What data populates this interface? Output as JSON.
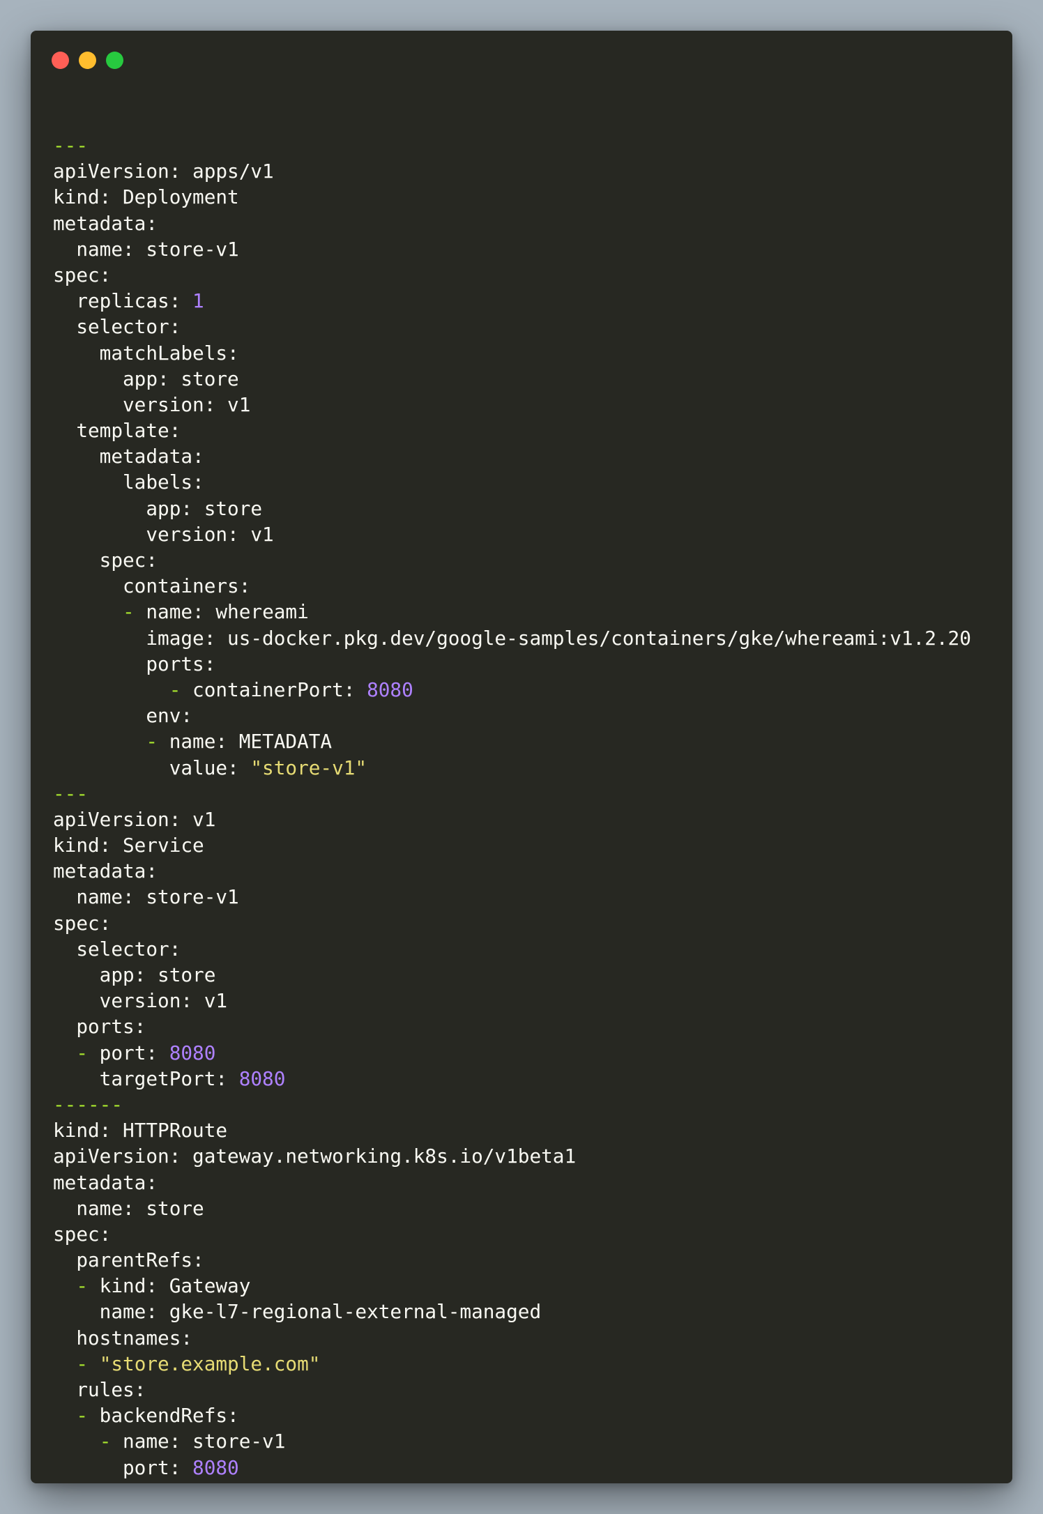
{
  "window": {
    "controls": [
      {
        "name": "close-button",
        "color": "#ff5f56"
      },
      {
        "name": "minimize-button",
        "color": "#ffbd2e"
      },
      {
        "name": "maximize-button",
        "color": "#27c93f"
      }
    ],
    "background": "#272822"
  },
  "colors": {
    "text": "#f8f8f2",
    "number": "#ae81ff",
    "string": "#e6db74",
    "punctuation": "#a6e22e"
  },
  "code": {
    "language": "yaml",
    "lines": [
      [
        {
          "t": "---",
          "c": "punc"
        }
      ],
      [
        {
          "t": "apiVersion: apps/v1",
          "c": "plain"
        }
      ],
      [
        {
          "t": "kind: Deployment",
          "c": "plain"
        }
      ],
      [
        {
          "t": "metadata:",
          "c": "plain"
        }
      ],
      [
        {
          "t": "  name: store-v1",
          "c": "plain"
        }
      ],
      [
        {
          "t": "spec:",
          "c": "plain"
        }
      ],
      [
        {
          "t": "  replicas: ",
          "c": "plain"
        },
        {
          "t": "1",
          "c": "num"
        }
      ],
      [
        {
          "t": "  selector:",
          "c": "plain"
        }
      ],
      [
        {
          "t": "    matchLabels:",
          "c": "plain"
        }
      ],
      [
        {
          "t": "      app: store",
          "c": "plain"
        }
      ],
      [
        {
          "t": "      version: v1",
          "c": "plain"
        }
      ],
      [
        {
          "t": "  template:",
          "c": "plain"
        }
      ],
      [
        {
          "t": "    metadata:",
          "c": "plain"
        }
      ],
      [
        {
          "t": "      labels:",
          "c": "plain"
        }
      ],
      [
        {
          "t": "        app: store",
          "c": "plain"
        }
      ],
      [
        {
          "t": "        version: v1",
          "c": "plain"
        }
      ],
      [
        {
          "t": "    spec:",
          "c": "plain"
        }
      ],
      [
        {
          "t": "      containers:",
          "c": "plain"
        }
      ],
      [
        {
          "t": "      ",
          "c": "plain"
        },
        {
          "t": "-",
          "c": "punc"
        },
        {
          "t": " name: whereami",
          "c": "plain"
        }
      ],
      [
        {
          "t": "        image: us-docker.pkg.dev/google-samples/containers/gke/whereami:v1.2.20",
          "c": "plain"
        }
      ],
      [
        {
          "t": "        ports:",
          "c": "plain"
        }
      ],
      [
        {
          "t": "          ",
          "c": "plain"
        },
        {
          "t": "-",
          "c": "punc"
        },
        {
          "t": " containerPort: ",
          "c": "plain"
        },
        {
          "t": "8080",
          "c": "num"
        }
      ],
      [
        {
          "t": "        env:",
          "c": "plain"
        }
      ],
      [
        {
          "t": "        ",
          "c": "plain"
        },
        {
          "t": "-",
          "c": "punc"
        },
        {
          "t": " name: METADATA",
          "c": "plain"
        }
      ],
      [
        {
          "t": "          value: ",
          "c": "plain"
        },
        {
          "t": "\"store-v1\"",
          "c": "str"
        }
      ],
      [
        {
          "t": "---",
          "c": "punc"
        }
      ],
      [
        {
          "t": "apiVersion: v1",
          "c": "plain"
        }
      ],
      [
        {
          "t": "kind: Service",
          "c": "plain"
        }
      ],
      [
        {
          "t": "metadata:",
          "c": "plain"
        }
      ],
      [
        {
          "t": "  name: store-v1",
          "c": "plain"
        }
      ],
      [
        {
          "t": "spec:",
          "c": "plain"
        }
      ],
      [
        {
          "t": "  selector:",
          "c": "plain"
        }
      ],
      [
        {
          "t": "    app: store",
          "c": "plain"
        }
      ],
      [
        {
          "t": "    version: v1",
          "c": "plain"
        }
      ],
      [
        {
          "t": "  ports:",
          "c": "plain"
        }
      ],
      [
        {
          "t": "  ",
          "c": "plain"
        },
        {
          "t": "-",
          "c": "punc"
        },
        {
          "t": " port: ",
          "c": "plain"
        },
        {
          "t": "8080",
          "c": "num"
        }
      ],
      [
        {
          "t": "    targetPort: ",
          "c": "plain"
        },
        {
          "t": "8080",
          "c": "num"
        }
      ],
      [
        {
          "t": "------",
          "c": "punc"
        }
      ],
      [
        {
          "t": "kind: HTTPRoute",
          "c": "plain"
        }
      ],
      [
        {
          "t": "apiVersion: gateway.networking.k8s.io/v1beta1",
          "c": "plain"
        }
      ],
      [
        {
          "t": "metadata:",
          "c": "plain"
        }
      ],
      [
        {
          "t": "  name: store",
          "c": "plain"
        }
      ],
      [
        {
          "t": "spec:",
          "c": "plain"
        }
      ],
      [
        {
          "t": "  parentRefs:",
          "c": "plain"
        }
      ],
      [
        {
          "t": "  ",
          "c": "plain"
        },
        {
          "t": "-",
          "c": "punc"
        },
        {
          "t": " kind: Gateway",
          "c": "plain"
        }
      ],
      [
        {
          "t": "    name: gke-l7-regional-external-managed",
          "c": "plain"
        }
      ],
      [
        {
          "t": "  hostnames:",
          "c": "plain"
        }
      ],
      [
        {
          "t": "  ",
          "c": "plain"
        },
        {
          "t": "-",
          "c": "punc"
        },
        {
          "t": " ",
          "c": "plain"
        },
        {
          "t": "\"store.example.com\"",
          "c": "str"
        }
      ],
      [
        {
          "t": "  rules:",
          "c": "plain"
        }
      ],
      [
        {
          "t": "  ",
          "c": "plain"
        },
        {
          "t": "-",
          "c": "punc"
        },
        {
          "t": " backendRefs:",
          "c": "plain"
        }
      ],
      [
        {
          "t": "    ",
          "c": "plain"
        },
        {
          "t": "-",
          "c": "punc"
        },
        {
          "t": " name: store-v1",
          "c": "plain"
        }
      ],
      [
        {
          "t": "      port: ",
          "c": "plain"
        },
        {
          "t": "8080",
          "c": "num"
        }
      ]
    ]
  }
}
